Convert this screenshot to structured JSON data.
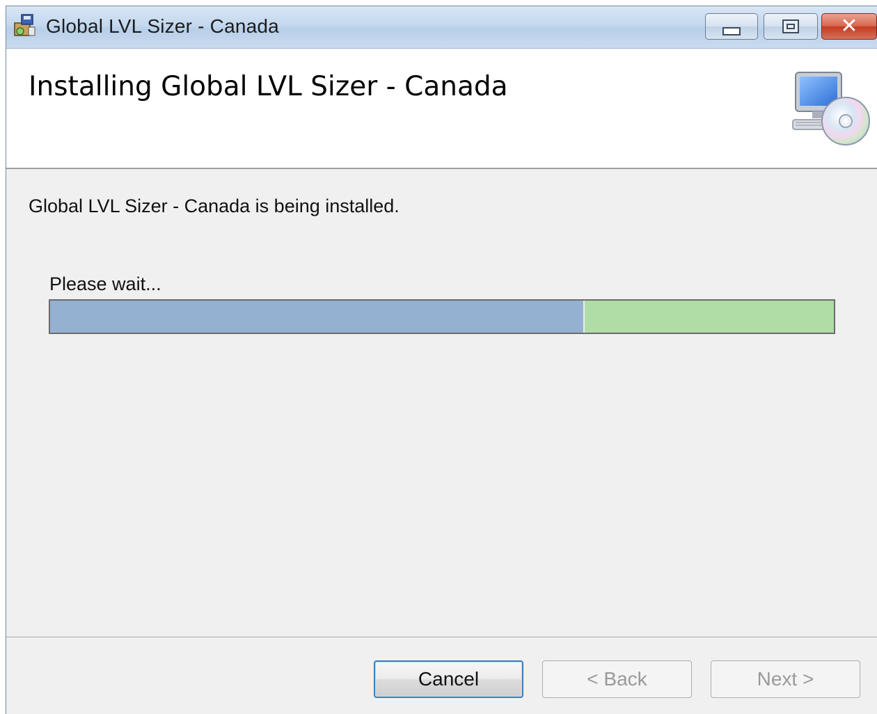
{
  "window": {
    "title": "Global LVL Sizer - Canada"
  },
  "banner": {
    "title": "Installing Global LVL Sizer - Canada"
  },
  "body": {
    "status": "Global LVL Sizer - Canada is being installed.",
    "wait_label": "Please wait...",
    "progress_fraction": 0.68
  },
  "buttons": {
    "cancel": "Cancel",
    "back": "< Back",
    "next": "Next >"
  },
  "icons": {
    "app": "installer-package-icon",
    "banner": "computer-cd-icon",
    "minimize": "minimize-icon",
    "maximize": "maximize-icon",
    "close": "close-icon"
  },
  "colors": {
    "progress_fill": "#94b1d1",
    "progress_track": "#b0dca5",
    "close_button": "#c43b22"
  }
}
